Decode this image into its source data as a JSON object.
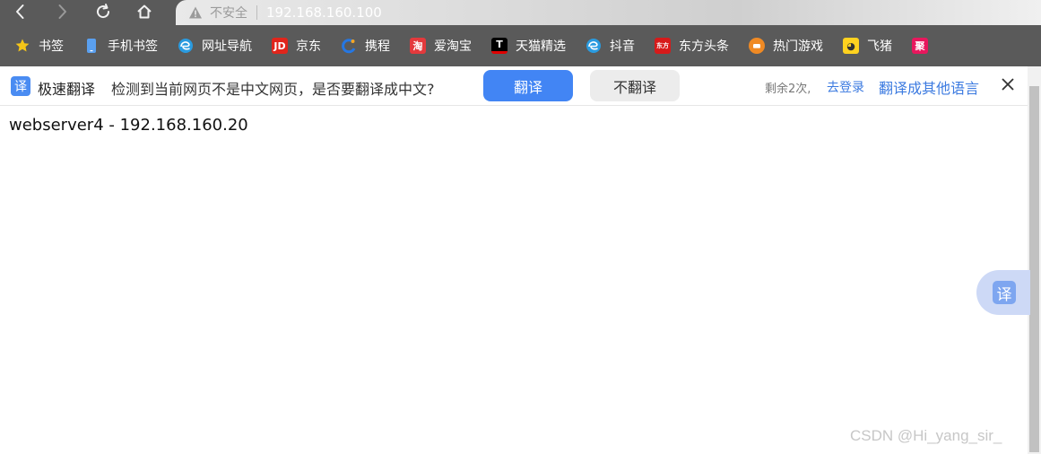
{
  "navbar": {
    "back_icon": "chevron-left-icon",
    "forward_icon": "chevron-right-icon",
    "reload_icon": "reload-icon",
    "home_icon": "home-icon"
  },
  "address_bar": {
    "security_label": "不安全",
    "url": "192.168.160.100"
  },
  "bookmarks": [
    {
      "label": "书签",
      "icon": "star-icon",
      "color": "#f5c518"
    },
    {
      "label": "手机书签",
      "icon": "phone-icon",
      "color": "#5aa0f0"
    },
    {
      "label": "网址导航",
      "icon": "edge-icon",
      "color": "#2a9be0"
    },
    {
      "label": "京东",
      "icon": "jd-icon",
      "color": "#e1251b"
    },
    {
      "label": "携程",
      "icon": "ctrip-icon",
      "color": "#2577e3"
    },
    {
      "label": "爱淘宝",
      "icon": "taobao-icon",
      "color": "#e4393c"
    },
    {
      "label": "天猫精选",
      "icon": "tmall-icon",
      "color": "#e00000"
    },
    {
      "label": "抖音",
      "icon": "edge-icon",
      "color": "#2a9be0"
    },
    {
      "label": "东方头条",
      "icon": "dongfang-icon",
      "color": "#d71a1a"
    },
    {
      "label": "热门游戏",
      "icon": "game-icon",
      "color": "#f08a24"
    },
    {
      "label": "飞猪",
      "icon": "fliggy-icon",
      "color": "#ffd21f"
    },
    {
      "label": "聚",
      "icon": "ju-icon",
      "color": "#e8175d"
    }
  ],
  "translate_bar": {
    "logo_char": "译",
    "name": "极速翻译",
    "message": "检测到当前网页不是中文网页，是否要翻译成中文?",
    "translate_button": "翻译",
    "no_translate_button": "不翻译",
    "remaining": "剩余2次,",
    "login_link": "去登录",
    "other_language_link": "翻译成其他语言",
    "close_icon": "close-icon"
  },
  "page": {
    "content": "webserver4 - 192.168.160.20"
  },
  "floating_translate": {
    "char": "译"
  },
  "watermark": "CSDN @Hi_yang_sir_"
}
